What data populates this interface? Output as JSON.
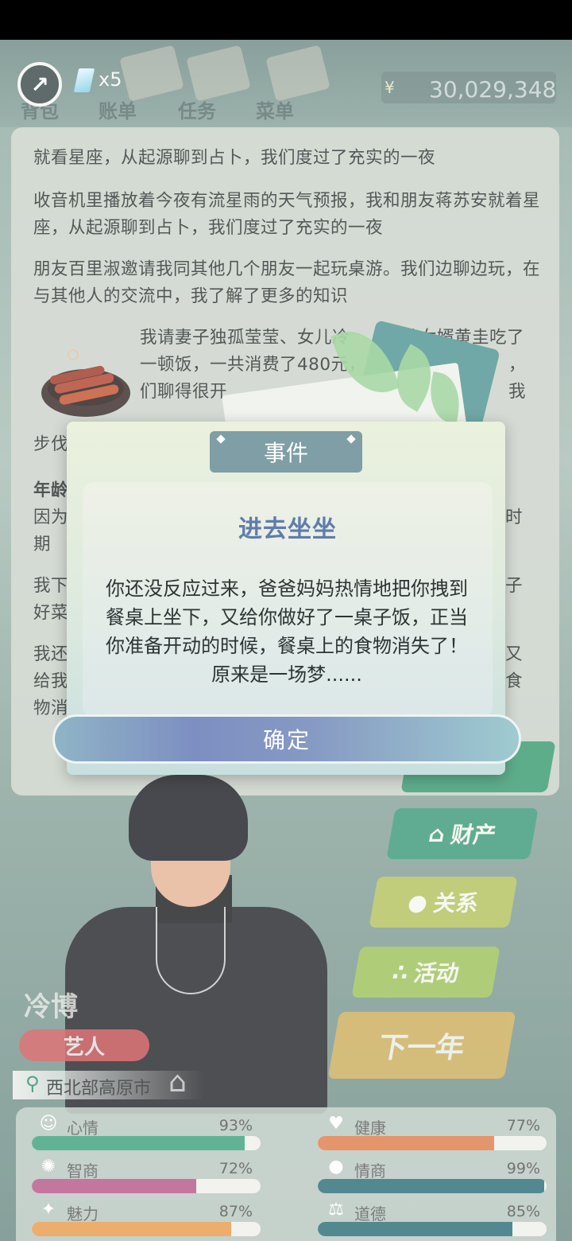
{
  "header": {
    "gem_count": "x5",
    "nav": [
      "背包",
      "账单",
      "任务",
      "菜单"
    ],
    "currency_symbol": "¥",
    "money": "30,029,348"
  },
  "story": {
    "lines": [
      "就看星座，从起源聊到占卜，我们度过了充实的一夜",
      "收音机里播放着今夜有流星雨的天气预报，我和朋友蒋苏安就着星座，从起源聊到占卜，我们度过了充实的一夜",
      "朋友百里淑邀请我同其他几个朋友一起玩桌游。我们边聊边玩，在与其他人的交流中，我了解了更多的知识",
      "我请妻子独孤莹莹、女儿冷",
      "准女婿黄圭吃了",
      "一顿饭，一共消费了480元，",
      "，我",
      "们聊得很开",
      "步伐逐",
      "年龄",
      "因为",
      "时",
      "期",
      "我下",
      "子",
      "好菜",
      "我还",
      "又",
      "给我",
      "食",
      "物消"
    ]
  },
  "side_buttons": {
    "finance": "财产",
    "social": "关系",
    "activity": "活动",
    "next_year": "下一年"
  },
  "character": {
    "name": "冷博",
    "job": "艺人",
    "location": "西北部高原市"
  },
  "stats": [
    {
      "label": "心情",
      "value": "93%",
      "fraction": 0.93,
      "color": "#3fa37f"
    },
    {
      "label": "健康",
      "value": "77%",
      "fraction": 0.77,
      "color": "#e07e4c"
    },
    {
      "label": "智商",
      "value": "72%",
      "fraction": 0.72,
      "color": "#b65a8a"
    },
    {
      "label": "情商",
      "value": "99%",
      "fraction": 0.99,
      "color": "#2c6f78"
    },
    {
      "label": "魅力",
      "value": "87%",
      "fraction": 0.87,
      "color": "#e89b4e"
    },
    {
      "label": "道德",
      "value": "85%",
      "fraction": 0.85,
      "color": "#2c6f78"
    }
  ],
  "dialog": {
    "tab": "事件",
    "title": "进去坐坐",
    "body": "你还没反应过来，爸爸妈妈热情地把你拽到餐桌上坐下，又给你做好了一桌子饭，正当你准备开动的时候，餐桌上的食物消失了！原来是一场梦......",
    "confirm": "确定"
  }
}
